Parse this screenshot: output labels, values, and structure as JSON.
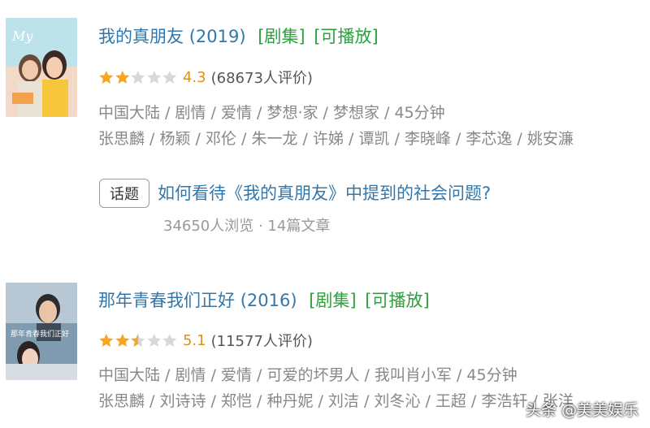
{
  "items": [
    {
      "title": "我的真朋友",
      "year": "(2019)",
      "tags": [
        "[剧集]",
        "[可播放]"
      ],
      "stars": 2,
      "half_star": false,
      "score": "4.3",
      "rating_count": "(68673人评价)",
      "meta_line": "中国大陆 / 剧情 / 爱情 / 梦想·家 / 梦想家 / 45分钟",
      "cast_line": "张思麟 / 杨颖 / 邓伦 / 朱一龙 / 许娣 / 谭凯 / 李晓峰 / 李芯逸 / 姚安濂",
      "poster_text": "My"
    },
    {
      "title": "那年青春我们正好",
      "year": "(2016)",
      "tags": [
        "[剧集]",
        "[可播放]"
      ],
      "stars": 2,
      "half_star": true,
      "score": "5.1",
      "rating_count": "(11577人评价)",
      "meta_line": "中国大陆 / 剧情 / 爱情 / 可爱的坏男人 / 我叫肖小军 / 45分钟",
      "cast_line": "张思麟 / 刘诗诗 / 郑恺 / 种丹妮 / 刘洁 / 刘冬沁 / 王超 / 李浩轩 / 张洋",
      "poster_text": "那年青春我们正好"
    }
  ],
  "topic": {
    "badge": "话题",
    "title": "如何看待《我的真朋友》中提到的社会问题?",
    "stats": "34650人浏览 · 14篇文章"
  },
  "watermark": "头条 @美美娱乐",
  "colors": {
    "link": "#3377aa",
    "tag": "#2d9f3c",
    "star": "#f5a623",
    "star_empty": "#d8d8d8",
    "meta": "#888888"
  }
}
